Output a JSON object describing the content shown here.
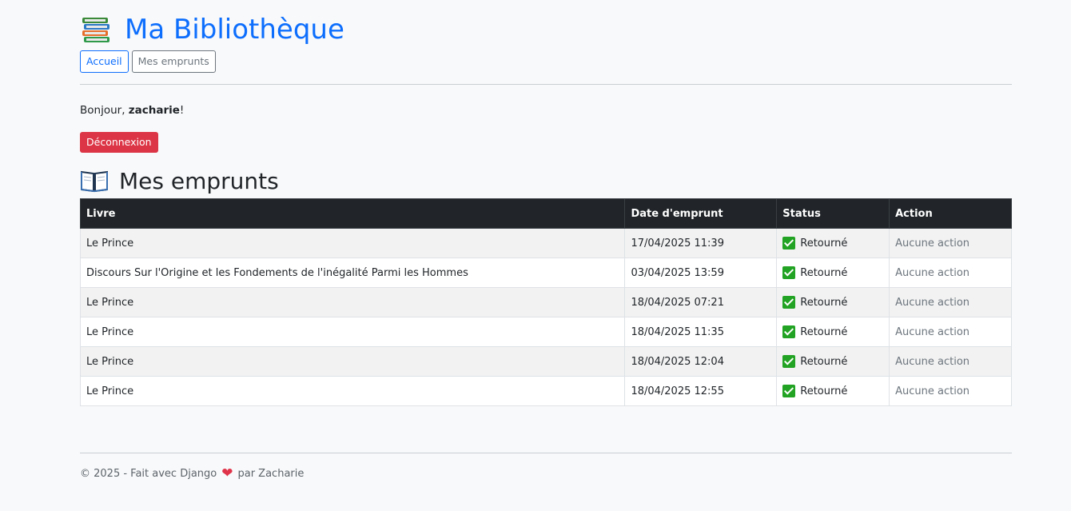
{
  "header": {
    "title": "Ma Bibliothèque",
    "icon": "books-icon",
    "nav": [
      {
        "label": "Accueil"
      },
      {
        "label": "Mes emprunts"
      }
    ]
  },
  "user": {
    "greeting_prefix": "Bonjour, ",
    "username": "zacharie",
    "greeting_suffix": "!",
    "logout_label": "Déconnexion"
  },
  "section": {
    "title": "Mes emprunts",
    "icon": "open-book-icon"
  },
  "table": {
    "columns": [
      "Livre",
      "Date d'emprunt",
      "Status",
      "Action"
    ],
    "rows": [
      {
        "livre": "Le Prince",
        "date": "17/04/2025 11:39",
        "status": "Retourné",
        "action": "Aucune action"
      },
      {
        "livre": "Discours Sur l'Origine et les Fondements de l'inégalité Parmi les Hommes",
        "date": "03/04/2025 13:59",
        "status": "Retourné",
        "action": "Aucune action"
      },
      {
        "livre": "Le Prince",
        "date": "18/04/2025 07:21",
        "status": "Retourné",
        "action": "Aucune action"
      },
      {
        "livre": "Le Prince",
        "date": "18/04/2025 11:35",
        "status": "Retourné",
        "action": "Aucune action"
      },
      {
        "livre": "Le Prince",
        "date": "18/04/2025 12:04",
        "status": "Retourné",
        "action": "Aucune action"
      },
      {
        "livre": "Le Prince",
        "date": "18/04/2025 12:55",
        "status": "Retourné",
        "action": "Aucune action"
      }
    ]
  },
  "footer": {
    "text_before": "© 2025 - Fait avec Django",
    "heart": "❤",
    "text_after": "par Zacharie"
  },
  "colors": {
    "primary": "#0d6efd",
    "danger": "#dc3545",
    "table_header": "#212529",
    "success": "#22a323"
  }
}
